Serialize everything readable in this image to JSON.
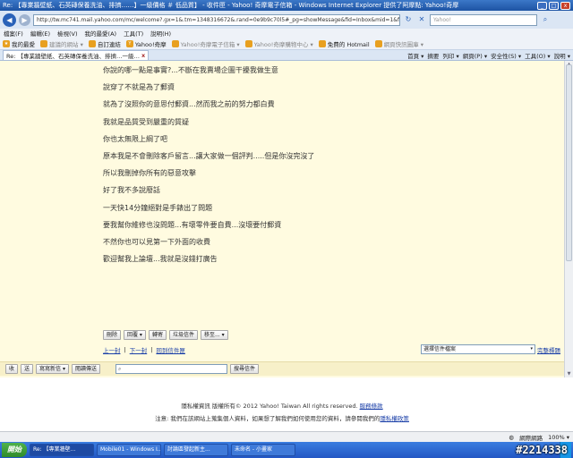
{
  "window": {
    "title": "Re: 【專業牆壁紙、石英磚保養洗油、排擠……】一級價格 ＃ 低品質】 - 收件匣 - Yahoo! 奇摩電子信箱 - Windows Internet Explorer 提供了阿摩點: Yahoo!奇摩",
    "btn_min": "_",
    "btn_max": "□",
    "btn_close": "x"
  },
  "address": {
    "back_glyph": "◀",
    "fwd_glyph": "▶",
    "url": "http://tw.mc741.mail.yahoo.com/mc/welcome?.gx=1&.tm=1348316672&.rand=0e9b9c70l5#_pg=showMessage&fid=Inbox&mid=1&fidSort=&sort=0&order=down&startMid=0",
    "refresh_glyph": "↻",
    "stop_glyph": "✕",
    "search_placeholder": "Yahoo!"
  },
  "menu": [
    "檔案(F)",
    "編輯(E)",
    "檢視(V)",
    "我的最愛(A)",
    "工具(T)",
    "說明(H)"
  ],
  "favorites": [
    {
      "label": "我的最愛",
      "dim": false
    },
    {
      "label": "建議的網站 ▾",
      "dim": true
    },
    {
      "label": "自訂連結",
      "dim": false
    },
    {
      "label": "Yahoo!奇摩",
      "dim": false
    },
    {
      "label": "Yahoo!奇摩電子信箱 ▾",
      "dim": true
    },
    {
      "label": "Yahoo!奇摩購物中心 ▾",
      "dim": true
    },
    {
      "label": "免費的 Hotmail",
      "dim": false
    },
    {
      "label": "網頁快訊圖庫 ▾",
      "dim": true
    }
  ],
  "tab": {
    "label": "Re: 【專業牆壁紙、石英磚保養洗油、排擠…一級…",
    "close": "x"
  },
  "toolbar": [
    "首頁 ▾",
    "摘要",
    "列印 ▾",
    "網頁(P) ▾",
    "安全性(S) ▾",
    "工具(O) ▾",
    "說明 ▾"
  ],
  "message": {
    "lines": [
      "你說的哪一點是事實?...不斷在我賣場企圖干擾我做生意",
      "說穿了不就是為了郵資",
      "就為了沒照你的意思付郵資...然而我之前的努力都白費",
      "我就是品質受到嚴重的質疑",
      "你也太無限上綱了吧",
      "原本我是不會刪除客戶留言...讓大家做一個評判.....但是你沒完沒了",
      "所以我刪掉你所有的惡意攻擊",
      "好了我不多說廢話",
      "一天快14分鐘絕對是手錶出了問題",
      "要我幫你維修也沒問題...有壞零件要自費...沒壞要付郵資",
      "不然你也可以見第一下外面的收費",
      "歡迎幫我上論壇...我就是沒錢打廣告"
    ]
  },
  "actions": {
    "delete": "刪除",
    "reply": "回覆 ▾",
    "forward": "轉寄",
    "spam": "垃圾信件",
    "move": "移至... ▾"
  },
  "pager": {
    "prev": "上一封",
    "sep": "|",
    "next": "下一封",
    "back_to_list": "回到信件匣"
  },
  "folder_select": {
    "value": "選擇信件檔案",
    "arrow": "▾"
  },
  "settings_link": "完整標題",
  "bottom": {
    "receive": "收",
    "sent": "送",
    "compose": "寫寫新信 ▾",
    "contacts": "閱讀傳送",
    "search_icon": "⌕",
    "search_btn": "搜尋信件"
  },
  "footer": {
    "copyright_prefix": "隱私權資訊 版權所有© 2012 Yahoo! Taiwan All rights reserved.",
    "copyright_link": "服務條款",
    "notice_prefix": "注意: 我們在該網站上蒐集個人資料，如果想了解我們如何使用您的資料，請參閱我們的",
    "notice_link": "隱私權政策"
  },
  "status": {
    "left": "",
    "zone": "網際網路",
    "zoom": "100% ▾"
  },
  "taskbar": {
    "start": "開始",
    "tasks": [
      "Re: 【專業牆壁...",
      "Mobile01 - Windows I...",
      "討論區發起新主...",
      "未命名 - 小畫家"
    ],
    "tray_time": ""
  },
  "watermark": "#2214338"
}
